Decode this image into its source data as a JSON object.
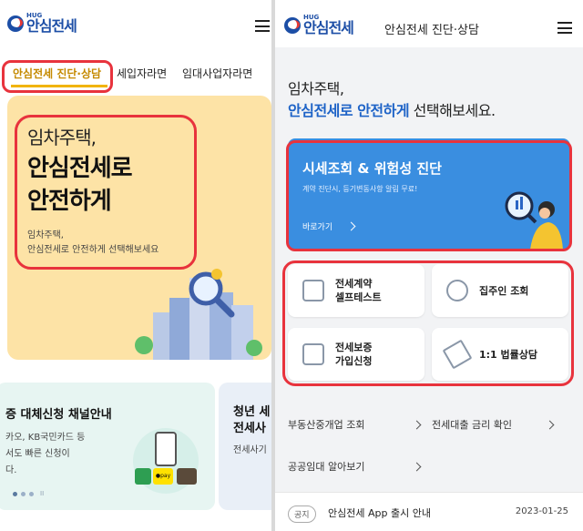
{
  "brand": {
    "hug": "HUG",
    "name": "안심전세"
  },
  "left": {
    "tabs": [
      {
        "label": "안심전세 진단·상담",
        "active": true
      },
      {
        "label": "세입자라면"
      },
      {
        "label": "임대사업자라면"
      }
    ],
    "hero": {
      "small": "임차주택,",
      "big_line1": "안심전세로",
      "big_line2": "안전하게",
      "sub_line1": "임차주택,",
      "sub_line2": "안심전세로 안전하게 선택해보세요"
    },
    "card1": {
      "title": "증 대체신청 채널안내",
      "line1": "카오, KB국민카드 등",
      "line2": "서도 빠른 신청이",
      "line3": "다.",
      "pay_label": "●pay"
    },
    "card2": {
      "title_line1": "청년 세",
      "title_line2": "전세사",
      "body": "전세사기"
    },
    "pager": "II"
  },
  "right": {
    "header_title": "안심전세 진단·상담",
    "intro_line1": "임차주택,",
    "intro_highlight": "안심전세로 안전하게",
    "intro_rest": " 선택해보세요.",
    "banner": {
      "title": "시세조회 & 위험성 진단",
      "subtitle": "계약 진단시, 등기변동사항 알림 무료!",
      "link": "바로가기"
    },
    "grid": [
      {
        "line1": "전세계약",
        "line2": "셀프테스트",
        "icon": "contract-icon"
      },
      {
        "line1": "집주인 조회",
        "line2": "",
        "icon": "owner-search-icon"
      },
      {
        "line1": "전세보증",
        "line2": "가입신청",
        "icon": "guarantee-apply-icon"
      },
      {
        "line1": "1:1 법률상담",
        "line2": "",
        "icon": "gavel-icon"
      }
    ],
    "links": [
      {
        "label": "부동산중개업 조회"
      },
      {
        "label": "전세대출 금리 확인"
      },
      {
        "label": "공공임대 알아보기"
      }
    ],
    "notice": {
      "badge": "공지",
      "text": "안심전세 App 출시 안내",
      "date": "2023-01-25"
    }
  },
  "colors": {
    "accent_blue": "#1e63c7",
    "banner_blue": "#3a8ee0",
    "highlight_red": "#e8333d",
    "tab_gold": "#f1b400",
    "hero_yellow": "#fde3a6"
  }
}
